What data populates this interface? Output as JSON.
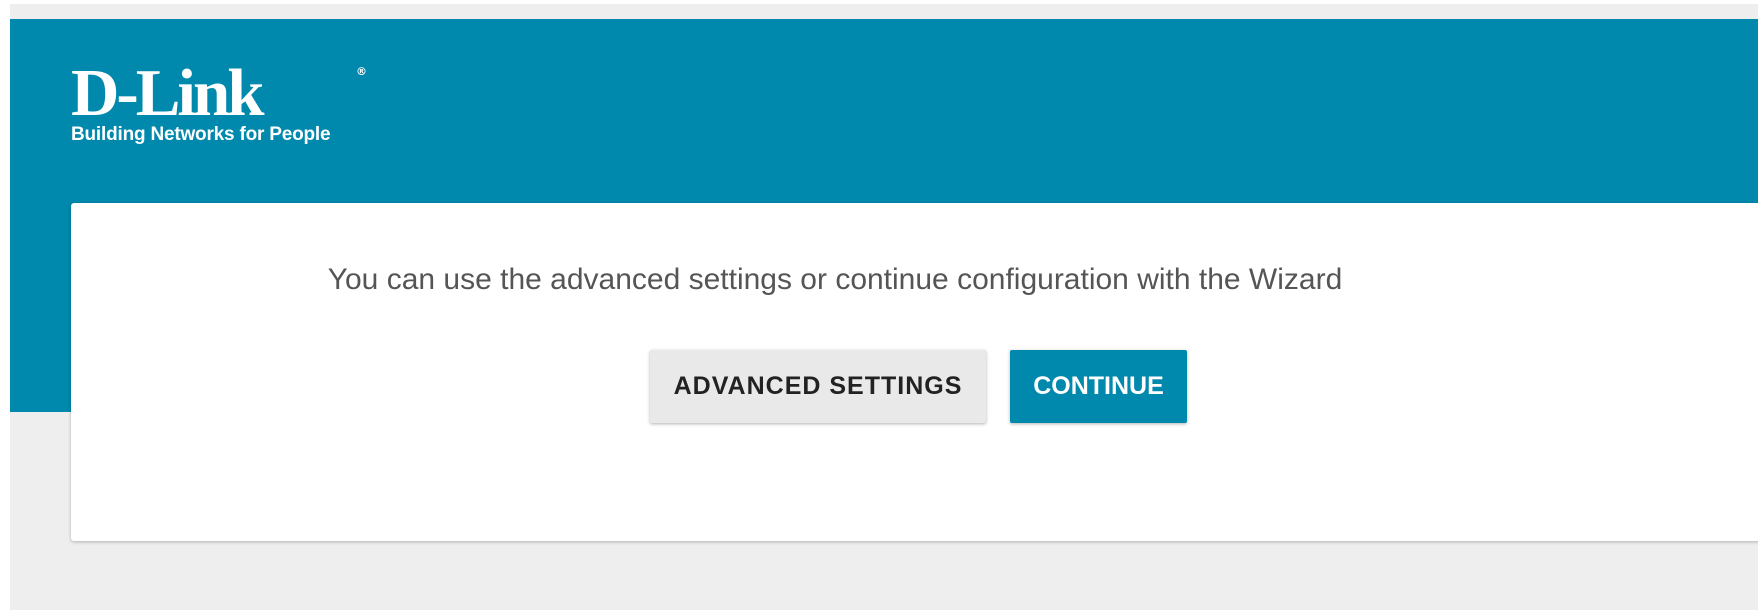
{
  "brand": {
    "logo_text": "D-Link",
    "registered_mark": "®",
    "tagline": "Building Networks for People"
  },
  "main": {
    "message": "You can use the advanced settings or continue configuration with the Wizard",
    "advanced_button_label": "ADVANCED SETTINGS",
    "continue_button_label": "CONTINUE"
  },
  "colors": {
    "header_bg": "#0088ad",
    "page_bg": "#eeeeee",
    "advanced_button_bg": "#e9e9e9",
    "continue_button_bg": "#0088ad"
  }
}
